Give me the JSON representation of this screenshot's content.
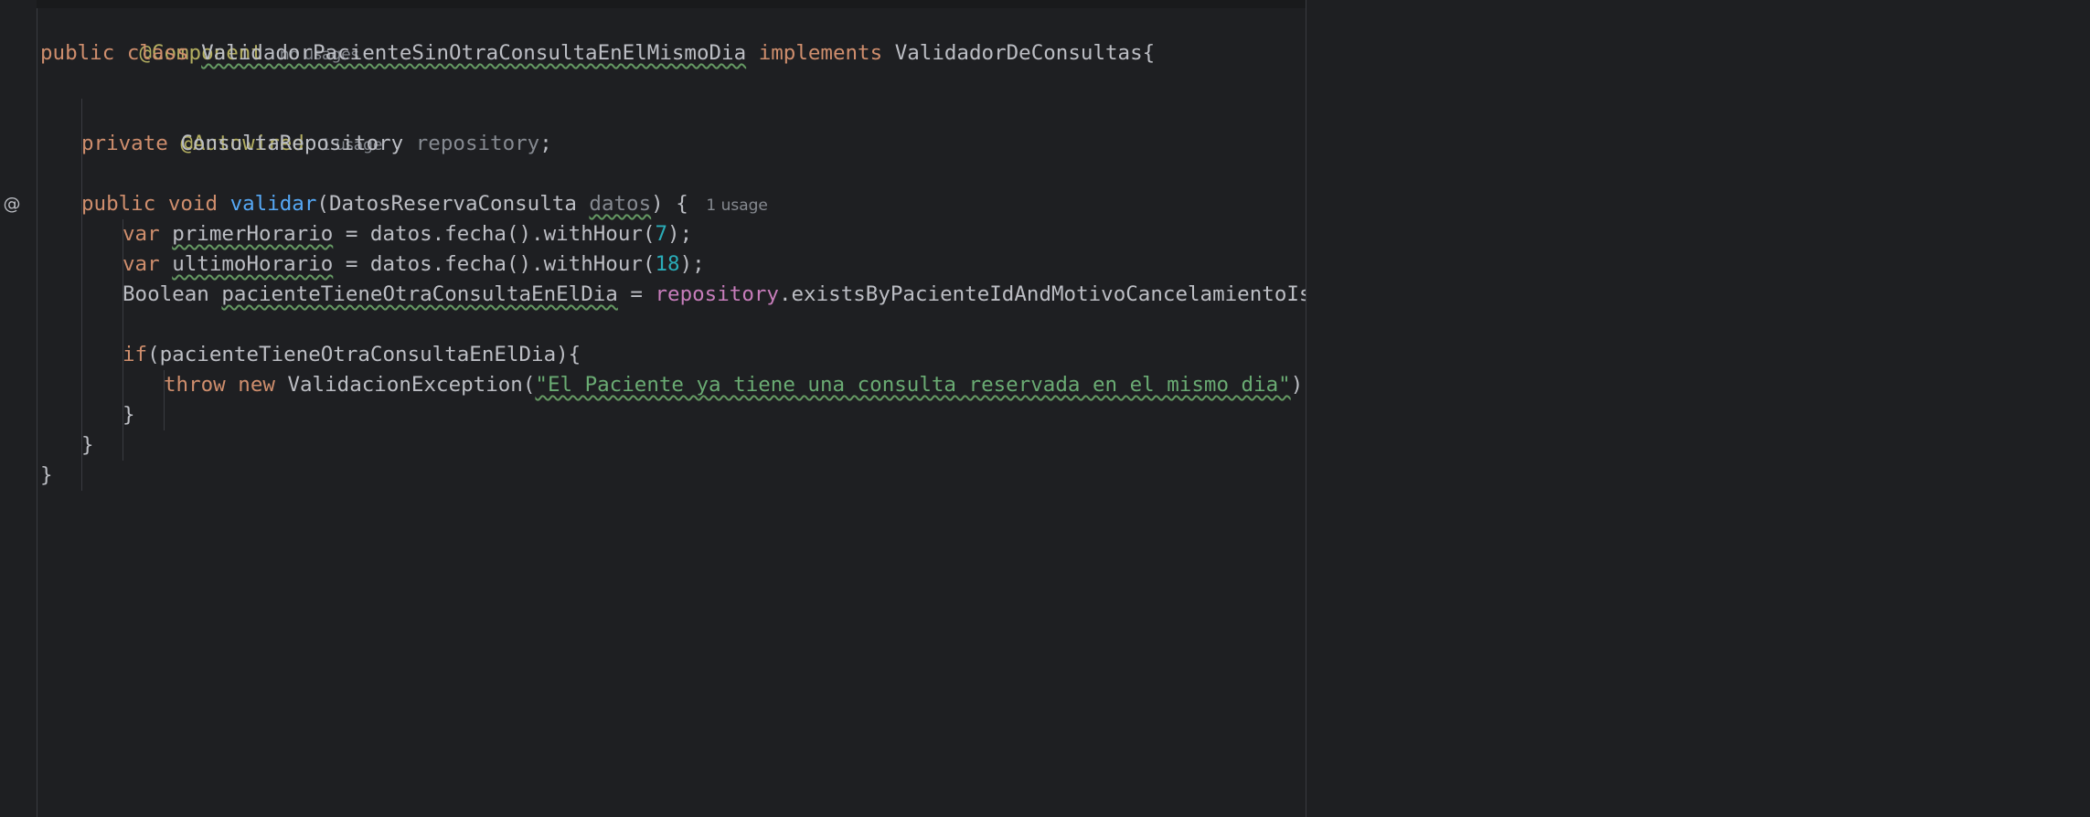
{
  "editor": {
    "theme": "dark",
    "language": "java",
    "background_color": "#1e1f22",
    "gutter_annotation_icon": "@",
    "colors": {
      "keyword": "#cf8e6d",
      "type": "#bcbec4",
      "method": "#56a8f5",
      "annotation": "#b3ae60",
      "string": "#6aab73",
      "number": "#2aacb8",
      "field": "#c77dbb",
      "dim_identifier": "#868a91",
      "inlay_hint": "#868a91",
      "spellcheck_squiggle": "#659963",
      "guide_line": "#393b40"
    }
  },
  "code": {
    "lines": [
      {
        "id": "line-annotation-component",
        "indent": 0,
        "text": "@Component",
        "inlay_hint": "no usages"
      },
      {
        "id": "line-class-declaration",
        "indent": 0,
        "keyword1": "public",
        "keyword2": "class",
        "class_name": "ValidadorPacienteSinOtraConsultaEnElMismoDia",
        "class_name_parts": [
          "Validador",
          "Paciente",
          "Sin",
          "OtraConsulta",
          "EnEl",
          "Mismo",
          "Dia"
        ],
        "keyword3": "implements",
        "interface_name": "ValidadorDeConsultas",
        "brace": "{"
      },
      {
        "id": "line-annotation-autowired",
        "indent": 1,
        "text": "@Autowired",
        "inlay_hint": "1 usage"
      },
      {
        "id": "line-field-repository",
        "indent": 1,
        "keyword": "private",
        "type": "ConsultaRepository",
        "name": "repository",
        "terminator": ";"
      },
      {
        "id": "line-method-validar",
        "indent": 1,
        "keyword1": "public",
        "keyword2": "void",
        "method_name": "validar",
        "param_type": "DatosReservaConsulta",
        "param_name": "datos",
        "brace": ") { ",
        "inlay_hint": "1 usage"
      },
      {
        "id": "line-var-primerhorario",
        "indent": 2,
        "keyword": "var",
        "var_name": "primerHorario",
        "expression": " = datos.fecha().withHour(",
        "number": "7",
        "tail": ");"
      },
      {
        "id": "line-var-ultimohorario",
        "indent": 2,
        "keyword": "var",
        "var_name": "ultimoHorario",
        "expression": " = datos.fecha().withHour(",
        "number": "18",
        "tail": ");"
      },
      {
        "id": "line-boolean-paciente",
        "indent": 2,
        "type": "Boolean",
        "var_name": "pacienteTieneOtraConsultaEnElDia",
        "assign": " = ",
        "field": "repository",
        "call": ".existsByPacienteIdAndMotivoCancelamientoIsNullAndFechaBetween(datos.id"
      },
      {
        "id": "line-if-condition",
        "indent": 2,
        "keyword": "if",
        "condition": "(pacienteTieneOtraConsultaEnElDia){"
      },
      {
        "id": "line-throw-exception",
        "indent": 3,
        "keyword1": "throw",
        "keyword2": "new",
        "exception_type": "ValidacionException",
        "open": "(",
        "string": "\"El Paciente ya tiene una consulta reservada en el mismo dia\"",
        "string_words": [
          "El",
          "Paciente",
          "ya",
          "tiene",
          "una",
          "consulta",
          "reservada",
          "en",
          "el",
          "mismo",
          "dia"
        ],
        "tail": ");"
      },
      {
        "id": "line-close-if",
        "indent": 2,
        "text": "}"
      },
      {
        "id": "line-close-method",
        "indent": 1,
        "text": "}"
      },
      {
        "id": "line-close-class",
        "indent": 0,
        "text": "}"
      }
    ]
  }
}
